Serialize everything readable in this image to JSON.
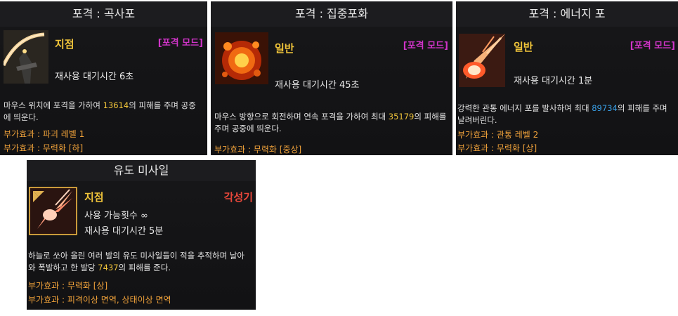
{
  "cards": [
    {
      "title": "포격 : 곡사포",
      "type": "지점",
      "mode": "[포격 모드]",
      "cooldown": "재사용 대기시간 6초",
      "desc_a": "마우스 위치에 포격을 가하여 ",
      "desc_num": "13614",
      "desc_b": "의 피해를 주며 공중에 띄운다.",
      "effects": [
        "부가효과 : 파괴 레벨 1",
        "부가효과 : 무력화 [하]"
      ],
      "icon": "howitzer-icon"
    },
    {
      "title": "포격 : 집중포화",
      "type": "일반",
      "mode": "[포격 모드]",
      "cooldown": "재사용 대기시간 45초",
      "desc_a": "마우스 방향으로 회전하며 연속 포격을 가하여 최대 ",
      "desc_num": "35179",
      "desc_b": "의 피해를 주며 공중에 띄운다.",
      "effects": [
        "부가효과 : 무력화 [중상]"
      ],
      "icon": "barrage-icon"
    },
    {
      "title": "포격 : 에너지 포",
      "type": "일반",
      "mode": "[포격 모드]",
      "cooldown": "재사용 대기시간 1분",
      "desc_a": "강력한 관통 에너지 포를 발사하여 최대 ",
      "desc_num": "89734",
      "desc_b": "의 피해를 주며 날려버린다.",
      "effects": [
        "부가효과 : 관통 레벨 2",
        "부가효과 : 무력화 [상]"
      ],
      "icon": "energy-cannon-icon"
    },
    {
      "title": "유도 미사일",
      "type": "지점",
      "awakening": "각성기",
      "uses": "사용 가능횟수 ∞",
      "cooldown": "재사용 대기시간 5분",
      "desc_a": "하늘로 쏘아 올린 여러 발의 유도 미사일들이 적을 추적하며 날아와 폭발하고 한 발당 ",
      "desc_num": "7437",
      "desc_b": "의 피해를 준다.",
      "effects": [
        "부가효과 : 무력화 [상]",
        "부가효과 : 피격이상 면역, 상태이상 면역"
      ],
      "icon": "guided-missile-icon"
    }
  ],
  "colors": {
    "type": "#f0c43a",
    "mode": "#d034c8",
    "awakening": "#e8473a",
    "effect": "#f0a23a",
    "number": "#f0c43a",
    "number_blue": "#39a0e6"
  }
}
